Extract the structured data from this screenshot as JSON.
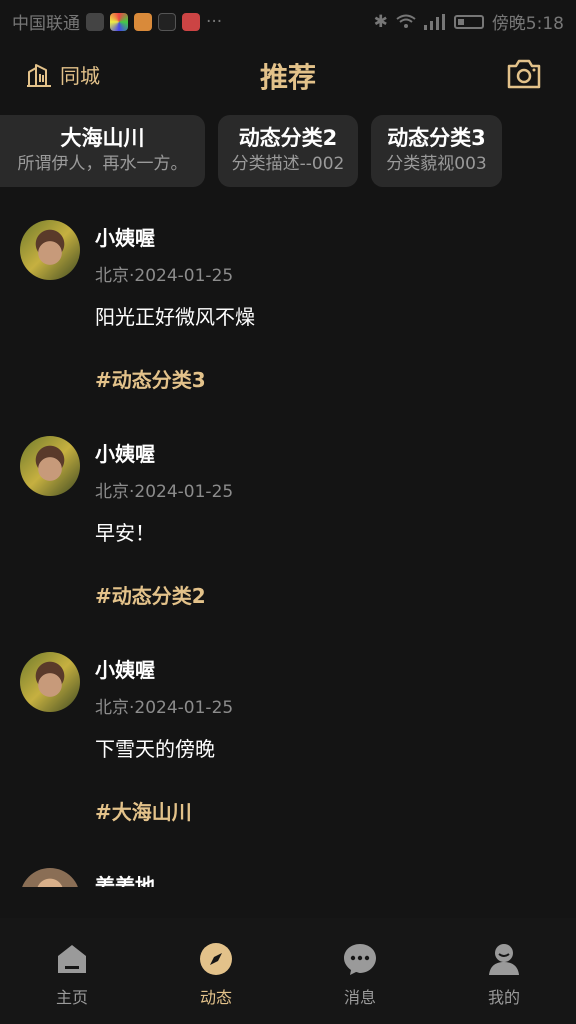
{
  "status_bar": {
    "carrier": "中国联通",
    "time": "傍晚5:18"
  },
  "header": {
    "city_label": "同城",
    "title": "推荐"
  },
  "categories": [
    {
      "title": "大海山川",
      "desc": "所谓伊人，再水一方。"
    },
    {
      "title": "动态分类2",
      "desc": "分类描述--002"
    },
    {
      "title": "动态分类3",
      "desc": "分类藐视003"
    }
  ],
  "posts": [
    {
      "author": "小姨喔",
      "meta": "北京·2024-01-25",
      "content": "阳光正好微风不燥",
      "tag": "#动态分类3"
    },
    {
      "author": "小姨喔",
      "meta": "北京·2024-01-25",
      "content": "早安！",
      "tag": "#动态分类2"
    },
    {
      "author": "小姨喔",
      "meta": "北京·2024-01-25",
      "content": "下雪天的傍晚",
      "tag": "#大海山川"
    }
  ],
  "partial_post": {
    "author": "姜姜地"
  },
  "tabs": [
    {
      "label": "主页",
      "icon": "home-icon",
      "active": false
    },
    {
      "label": "动态",
      "icon": "compass-icon",
      "active": true
    },
    {
      "label": "消息",
      "icon": "message-icon",
      "active": false
    },
    {
      "label": "我的",
      "icon": "user-icon",
      "active": false
    }
  ],
  "colors": {
    "accent": "#e3c28a",
    "background": "#141414",
    "chip_bg": "#2a2a2a"
  }
}
